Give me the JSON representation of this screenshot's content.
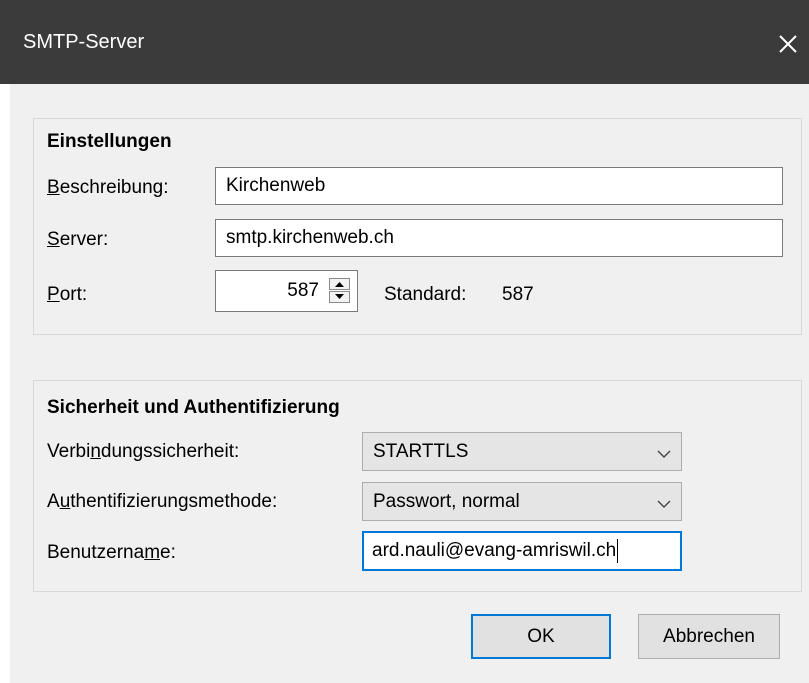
{
  "window": {
    "title": "SMTP-Server"
  },
  "settings": {
    "group_title": "Einstellungen",
    "description": {
      "label_mnemonic": "B",
      "label_rest": "eschreibung:",
      "value": "Kirchenweb"
    },
    "server": {
      "label_mnemonic": "S",
      "label_rest": "erver:",
      "value": "smtp.kirchenweb.ch"
    },
    "port": {
      "label_mnemonic": "P",
      "label_rest": "ort:",
      "value": "587",
      "default_label": "Standard:",
      "default_value": "587"
    }
  },
  "security": {
    "group_title": "Sicherheit und Authentifizierung",
    "connection": {
      "label_pre": "Verbi",
      "label_mnemonic": "n",
      "label_post": "dungssicherheit:",
      "value": "STARTTLS"
    },
    "auth_method": {
      "label_pre": "A",
      "label_mnemonic": "u",
      "label_post": "thentifizierungsmethode:",
      "value": "Passwort, normal"
    },
    "username": {
      "label_pre": "Benutzerna",
      "label_mnemonic": "m",
      "label_post": "e:",
      "value": "ard.nauli@evang-amriswil.ch"
    }
  },
  "buttons": {
    "ok": "OK",
    "cancel": "Abbrechen"
  },
  "icons": {
    "close": "close-icon",
    "spin_up": "arrow-up-icon",
    "spin_down": "arrow-down-icon",
    "dropdown": "chevron-down-icon"
  },
  "colors": {
    "titlebar": "#3b3b3b",
    "focus": "#0078d7",
    "dialog": "#f0f0f0"
  }
}
